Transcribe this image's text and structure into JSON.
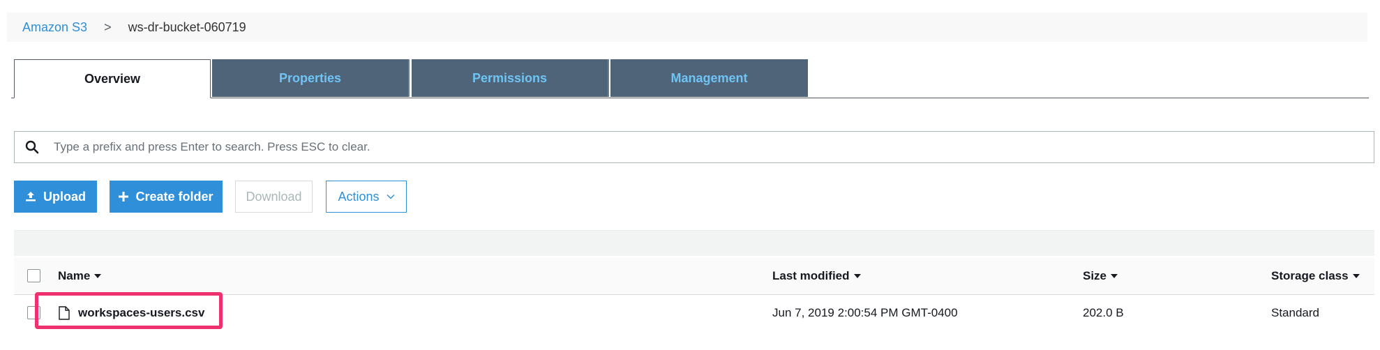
{
  "breadcrumb": {
    "root": "Amazon S3",
    "separator": ">",
    "current": "ws-dr-bucket-060719"
  },
  "tabs": [
    {
      "label": "Overview",
      "active": true
    },
    {
      "label": "Properties",
      "active": false
    },
    {
      "label": "Permissions",
      "active": false
    },
    {
      "label": "Management",
      "active": false
    }
  ],
  "search": {
    "placeholder": "Type a prefix and press Enter to search. Press ESC to clear.",
    "value": "",
    "icon": "search-icon"
  },
  "toolbar": {
    "upload_label": "Upload",
    "upload_icon": "upload-icon",
    "create_folder_label": "Create folder",
    "create_folder_icon": "plus-icon",
    "download_label": "Download",
    "actions_label": "Actions",
    "actions_icon": "chevron-down-icon"
  },
  "table": {
    "columns": [
      "Name",
      "Last modified",
      "Size",
      "Storage class"
    ],
    "rows": [
      {
        "name": "workspaces-users.csv",
        "icon": "file-icon",
        "last_modified": "Jun 7, 2019 2:00:54 PM GMT-0400",
        "size": "202.0 B",
        "storage_class": "Standard",
        "highlighted": true
      }
    ]
  },
  "colors": {
    "link": "#2d8fd5",
    "tab_bg": "#4f6478",
    "tab_text": "#6ec4f5",
    "primary": "#2f8fd8",
    "highlight": "#f0316f"
  }
}
